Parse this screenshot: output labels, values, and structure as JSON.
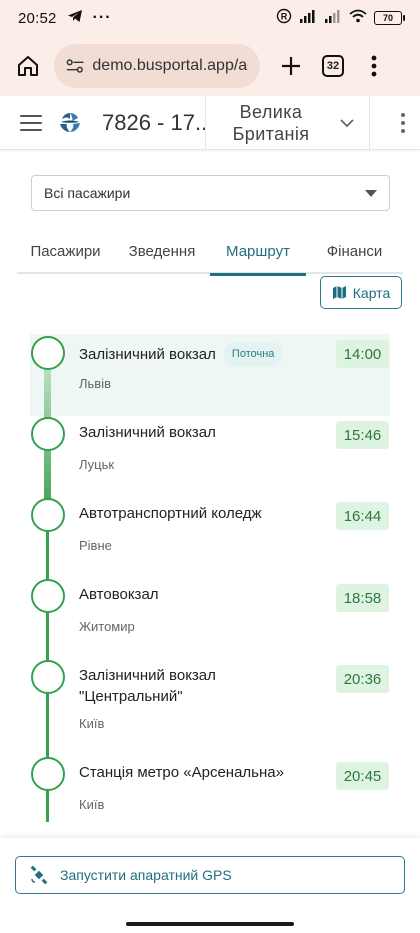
{
  "status_bar": {
    "time": "20:52",
    "battery": "70"
  },
  "browser": {
    "url": "demo.busportal.app/adr",
    "tab_count": "32"
  },
  "header": {
    "trip_title": "7826 - 17...",
    "country_line1": "Велика",
    "country_line2": "Британія"
  },
  "filter": {
    "passenger_select": "Всі пасажири"
  },
  "tabs": [
    {
      "label": "Пасажири"
    },
    {
      "label": "Зведення"
    },
    {
      "label": "Маршрут",
      "active": true
    },
    {
      "label": "Фінанси"
    }
  ],
  "map_button": {
    "label": "Карта"
  },
  "route": {
    "current_badge": "Поточна",
    "stops": [
      {
        "name": "Залізничний вокзал",
        "city": "Львів",
        "time": "14:00",
        "current": true
      },
      {
        "name": "Залізничний вокзал",
        "city": "Луцьк",
        "time": "15:46"
      },
      {
        "name": "Автотранспортний коледж",
        "city": "Рівне",
        "time": "16:44"
      },
      {
        "name": "Автовокзал",
        "city": "Житомир",
        "time": "18:58"
      },
      {
        "name": "Залізничний вокзал \"Центральний\"",
        "city": "Київ",
        "time": "20:36"
      },
      {
        "name": "Станція метро «Арсенальна»",
        "city": "Київ",
        "time": "20:45"
      }
    ]
  },
  "gps_button": {
    "label": "Запустити апаратний GPS"
  },
  "colors": {
    "accent": "#1f6f80",
    "route_green": "#35a14d",
    "time_bg": "#dff3e3"
  }
}
